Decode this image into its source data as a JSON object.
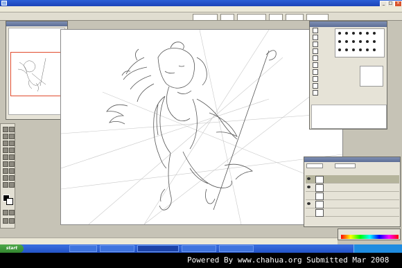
{
  "footer": {
    "watermark": "Powered By www.chahua.org  Submitted Mar 2008"
  },
  "taskbar": {
    "start_label": "start"
  },
  "colors": {
    "titlebar": "#2c5fd6",
    "taskbar": "#2454c8",
    "footer_bg": "#000000",
    "footer_text": "#ffffff",
    "navigator_frame": "#e04a2c",
    "canvas": "#ffffff"
  },
  "icons": {
    "window_minimize": "minimize-icon",
    "window_maximize": "maximize-icon",
    "window_close": "close-icon",
    "layer_visibility": "eye-icon"
  }
}
